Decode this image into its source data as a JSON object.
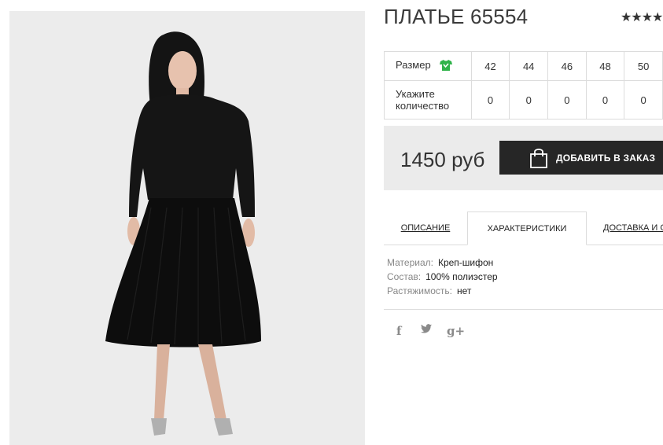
{
  "product": {
    "title": "ПЛАТЬЕ 65554",
    "rating_stars": "★★★★",
    "price": "1450 руб"
  },
  "sizes": {
    "size_label": "Размер",
    "qty_label": "Укажите количество",
    "values": [
      "42",
      "44",
      "46",
      "48",
      "50"
    ],
    "quantities": [
      "0",
      "0",
      "0",
      "0",
      "0"
    ]
  },
  "buy": {
    "add_button": "ДОБАВИТЬ В ЗАКАЗ"
  },
  "tabs": [
    "ОПИСАНИЕ",
    "ХАРАКТЕРИСТИКИ",
    "ДОСТАВКА И О"
  ],
  "specs": [
    {
      "key": "Материал:",
      "value": "Креп-шифон"
    },
    {
      "key": "Состав:",
      "value": "100% полиэстер"
    },
    {
      "key": "Растяжимость:",
      "value": "нет"
    }
  ],
  "social": {
    "facebook": "f",
    "twitter": "🐦",
    "googleplus": "g+"
  },
  "colors": {
    "button_bg": "#262626",
    "buybox_bg": "#ebebeb",
    "tshirt_icon": "#2fb34a"
  }
}
